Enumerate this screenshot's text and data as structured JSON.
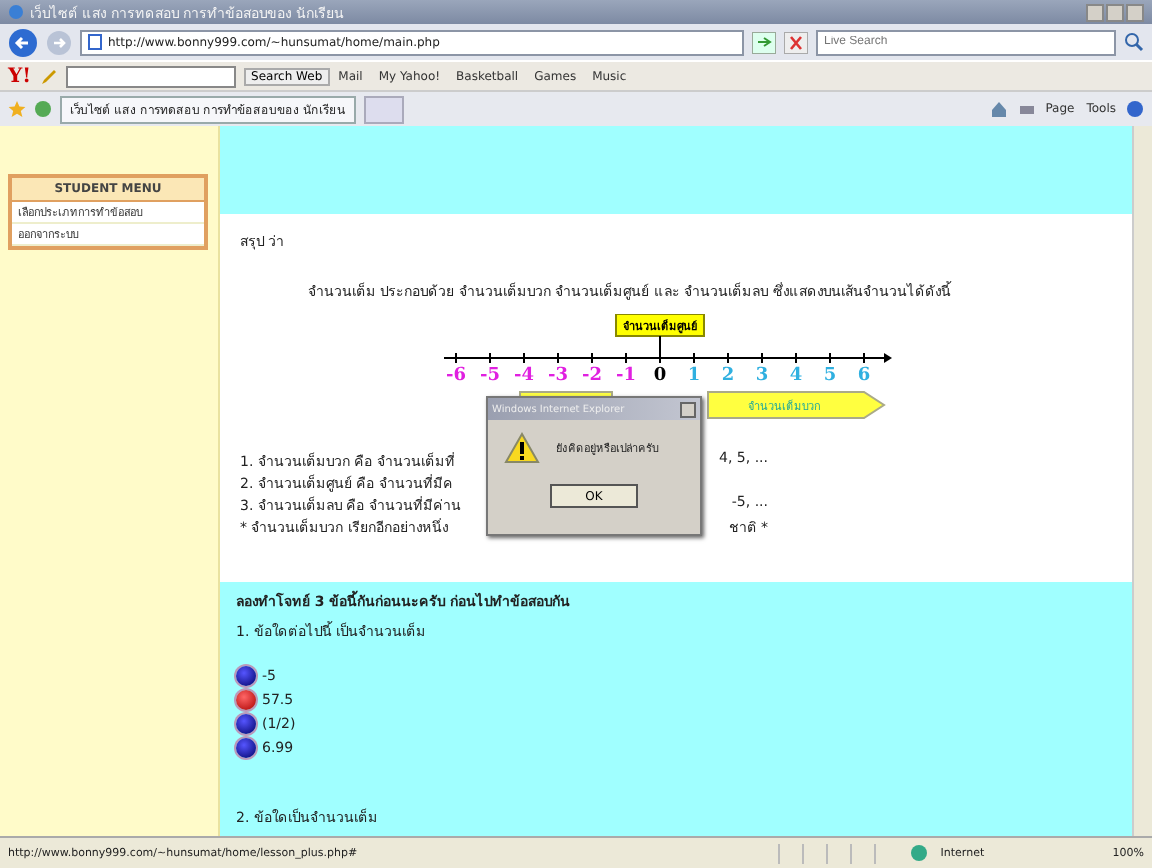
{
  "window": {
    "title": "เว็บไซต์ แสง การทดสอบ การทำข้อสอบของ นักเรียน"
  },
  "address_bar": {
    "url": "http://www.bonny999.com/~hunsumat/home/main.php",
    "search_placeholder": "Live Search"
  },
  "yahoo_toolbar": {
    "logo": "Y!",
    "search_button": "Search Web",
    "items": [
      "Mail",
      "My Yahoo!",
      "Basketball",
      "Games",
      "Music"
    ]
  },
  "tabs": [
    {
      "label": "เว็บไซต์ แสง การทดสอบ การทำข้อสอบของ นักเรียน",
      "selected": true
    }
  ],
  "command_bar": [
    "Page",
    "Tools"
  ],
  "sidebar": {
    "heading": "STUDENT MENU",
    "items": [
      "เลือกประเภทการทำข้อสอบ",
      "ออกจากระบบ"
    ]
  },
  "content": {
    "summary_label": "สรุป ว่า",
    "intro": "จำนวนเต็ม ประกอบด้วย จำนวนเต็มบวก จำนวนเต็มศูนย์ และ จำนวนเต็มลบ ซึ่งแสดงบนเส้นจำนวนได้ดังนี้",
    "number_line": {
      "zero_label": "จำนวนเต็มศูนย์",
      "positive_label": "จำนวนเต็มบวก",
      "numbers": [
        {
          "text": "-6",
          "kind": "negative"
        },
        {
          "text": "-5",
          "kind": "negative"
        },
        {
          "text": "-4",
          "kind": "negative"
        },
        {
          "text": "-3",
          "kind": "negative"
        },
        {
          "text": "-2",
          "kind": "negative"
        },
        {
          "text": "-1",
          "kind": "negative"
        },
        {
          "text": "0",
          "kind": "zero"
        },
        {
          "text": "1",
          "kind": "positive"
        },
        {
          "text": "2",
          "kind": "positive"
        },
        {
          "text": "3",
          "kind": "positive"
        },
        {
          "text": "4",
          "kind": "positive"
        },
        {
          "text": "5",
          "kind": "positive"
        },
        {
          "text": "6",
          "kind": "positive"
        }
      ]
    },
    "definitions": [
      {
        "start": "1. จำนวนเต็มบวก คือ จำนวนเต็มที่",
        "end": "4, 5, ..."
      },
      {
        "start": "2. จำนวนเต็มศูนย์ คือ จำนวนที่มีค"
      },
      {
        "start": "3. จำนวนเต็มลบ คือ จำนวนที่มีค่าน",
        "end": "-5, ..."
      },
      {
        "start": "* จำนวนเต็มบวก เรียกอีกอย่างหนึ่ง",
        "end": "ชาติ *"
      }
    ],
    "exercise_heading": "ลองทำโจทย์ 3 ข้อนี้กันก่อนนะครับ ก่อนไปทำข้อสอบกัน",
    "questions": [
      {
        "text": "1. ข้อใดต่อไปนี้ เป็นจำนวนเต็ม",
        "options": [
          {
            "label": "-5",
            "selected": false
          },
          {
            "label": "57.5",
            "selected": true
          },
          {
            "label": "(1/2)",
            "selected": false
          },
          {
            "label": "6.99",
            "selected": false
          }
        ]
      },
      {
        "text": "2. ข้อใดเป็นจำนวนเต็ม"
      }
    ]
  },
  "dialog": {
    "title": "Windows Internet Explorer",
    "message": "ยังคิดอยู่หรือเปล่าครับ",
    "button": "OK"
  },
  "status_bar": {
    "url": "http://www.bonny999.com/~hunsumat/home/lesson_plus.php#",
    "zone": "Internet",
    "zoom": "100%"
  }
}
